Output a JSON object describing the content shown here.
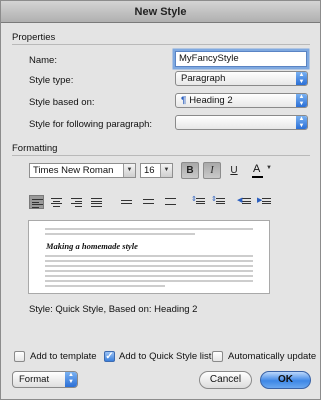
{
  "window": {
    "title": "New Style"
  },
  "properties": {
    "section_label": "Properties",
    "name_label": "Name:",
    "name_value": "MyFancyStyle",
    "style_type_label": "Style type:",
    "style_type_value": "Paragraph",
    "based_on_label": "Style based on:",
    "based_on_icon": "paragraph-mark",
    "based_on_value": "Heading 2",
    "following_label": "Style for following paragraph:",
    "following_value": ""
  },
  "formatting": {
    "section_label": "Formatting",
    "font_name": "Times New Roman",
    "font_size": "16",
    "bold_label": "B",
    "italic_label": "I",
    "underline_label": "U",
    "font_color_label": "A",
    "font_color": "#000000",
    "bold_active": true,
    "italic_active": true
  },
  "preview": {
    "heading_text": "Making a homemade style"
  },
  "style_description": "Style: Quick Style, Based on: Heading 2",
  "options": {
    "add_to_template_label": "Add to template",
    "add_to_template_checked": false,
    "add_to_quick_style_label": "Add to Quick Style list",
    "add_to_quick_style_checked": true,
    "auto_update_label": "Automatically update",
    "auto_update_checked": false
  },
  "footer": {
    "format_label": "Format",
    "cancel_label": "Cancel",
    "ok_label": "OK"
  },
  "colors": {
    "accent": "#3e87e6",
    "dialog_bg": "#e4e4e4"
  }
}
